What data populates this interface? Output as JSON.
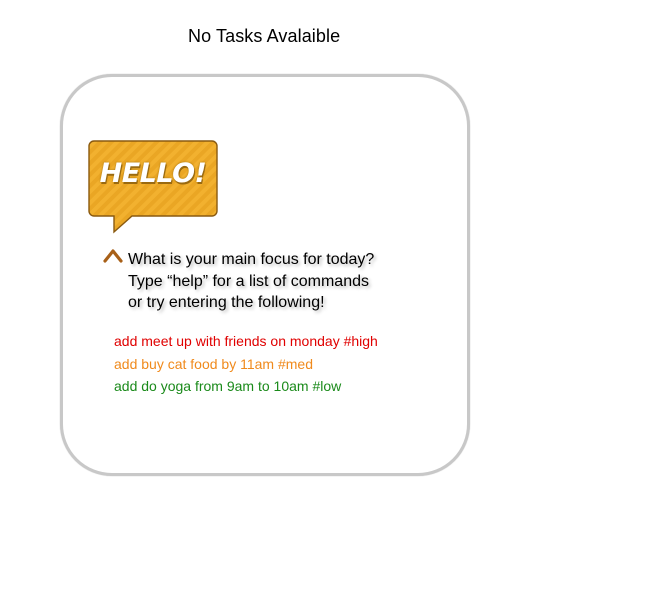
{
  "header": {
    "status_text": "No Tasks Avalaible"
  },
  "greeting": {
    "bubble_text": "HELLO!",
    "bubble_color": "#f2b12f"
  },
  "prompt": {
    "line1": "What is your main focus for today?",
    "line2": "Type “help” for a list of commands",
    "line3": "or try entering the following!"
  },
  "examples": [
    {
      "text": "add meet up with friends on monday #high",
      "color": "#e00000"
    },
    {
      "text": "add buy cat food by 11am #med",
      "color": "#f08a1c"
    },
    {
      "text": "add do yoga from 9am to 10am #low",
      "color": "#1a8a1a"
    }
  ],
  "icons": {
    "caret": "caret-up-icon",
    "bubble": "speech-bubble-icon"
  }
}
